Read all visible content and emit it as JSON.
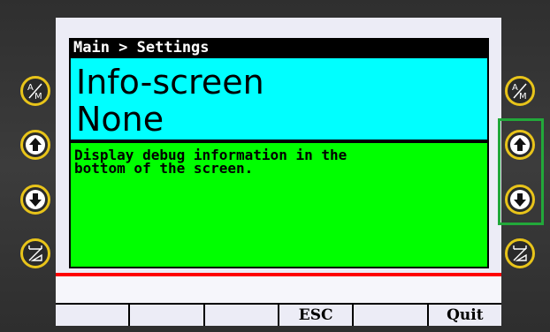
{
  "breadcrumb": "Main > Settings",
  "setting": {
    "name": "Info-screen",
    "value": "None",
    "description_lines": [
      "Display debug information in the",
      "bottom of the screen."
    ]
  },
  "softkeys": [
    "",
    "",
    "",
    "ESC",
    "",
    "Quit"
  ],
  "left_buttons": [
    {
      "name": "auto-manual-icon"
    },
    {
      "name": "arrow-up-icon"
    },
    {
      "name": "arrow-down-icon"
    },
    {
      "name": "hand-auto-icon"
    }
  ],
  "right_buttons": [
    {
      "name": "auto-manual-icon"
    },
    {
      "name": "arrow-up-icon"
    },
    {
      "name": "arrow-down-icon"
    },
    {
      "name": "hand-auto-icon"
    }
  ],
  "colors": {
    "header_bg": "#000000",
    "value_bg": "#00ffff",
    "description_bg": "#00ff00",
    "separator": "#ff0000",
    "button_ring": "#e8c41a",
    "highlight": "#22a83a"
  }
}
